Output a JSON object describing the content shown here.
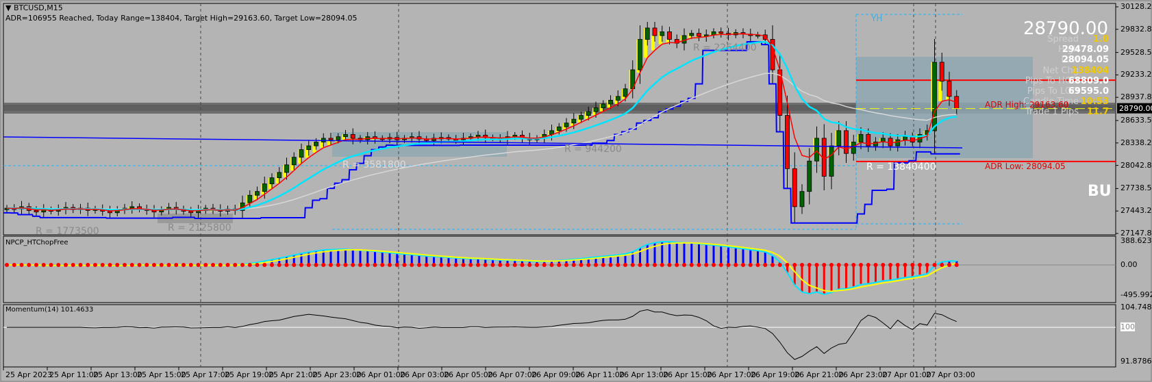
{
  "header": {
    "symbol": "BTCUSD,M15",
    "adr_line": "ADR=106955 Reached, Today Range=138404, Target High=29163.60, Target Low=28094.05"
  },
  "info_panel": {
    "price": "28790.00",
    "rows": [
      {
        "label": "Spread",
        "value": "1.0",
        "color": "#f0c800"
      },
      {
        "label": "High",
        "value": "29478.09",
        "color": "#ffffff"
      },
      {
        "label": "Low",
        "value": "28094.05",
        "color": "#ffffff"
      },
      {
        "label": "Net Chg",
        "value": "138404",
        "color": "#f0c800"
      },
      {
        "label": "Pips To HOD",
        "value": "68809.0",
        "color": "#ffffff"
      },
      {
        "label": "Pips To LOD",
        "value": "69595.0",
        "color": "#ffffff"
      },
      {
        "label": "Candle Time",
        "value": "10:53",
        "color": "#f0c800"
      },
      {
        "label": "Trade 1 Pips",
        "value": "11.7",
        "color": "#f0c800"
      }
    ],
    "bias": "BU"
  },
  "annotations": {
    "adr_high": "ADR High: 29163.60",
    "adr_low": "ADR Low: 28094.05",
    "yh": "YH",
    "ranges": [
      "R = 1773500",
      "R = 2125800",
      "R = 3581800",
      "R = 944200",
      "R = 2264400",
      "R = 13840400"
    ]
  },
  "colors": {
    "bg": "#b4b4b4",
    "bull": "#006400",
    "bear": "#ff0000",
    "adr": "#ff0000",
    "cyan": "#00e5ff",
    "blue": "#0000ff"
  },
  "chart_data": {
    "type": "line",
    "title": "BTCUSD,M15",
    "price_axis": {
      "ticks": [
        "30128.20",
        "29832.85",
        "29528.55",
        "29233.20",
        "28937.85",
        "28633.55",
        "28338.20",
        "28042.85",
        "27738.55",
        "27443.20",
        "27147.85"
      ],
      "ylim": [
        27147.85,
        30128.2
      ],
      "current": "28790.00"
    },
    "time_axis": {
      "ticks": [
        "25 Apr 2023",
        "25 Apr 11:00",
        "25 Apr 13:00",
        "25 Apr 15:00",
        "25 Apr 17:00",
        "25 Apr 19:00",
        "25 Apr 21:00",
        "25 Apr 23:00",
        "26 Apr 01:00",
        "26 Apr 03:00",
        "26 Apr 05:00",
        "26 Apr 07:00",
        "26 Apr 09:00",
        "26 Apr 11:00",
        "26 Apr 13:00",
        "26 Apr 15:00",
        "26 Apr 17:00",
        "26 Apr 19:00",
        "26 Apr 21:00",
        "26 Apr 23:00",
        "27 Apr 01:00",
        "27 Apr 03:00"
      ]
    },
    "adr_high": 29163.6,
    "adr_low": 28094.05,
    "closes": [
      27480,
      27470,
      27500,
      27450,
      27430,
      27460,
      27440,
      27470,
      27490,
      27460,
      27480,
      27450,
      27470,
      27440,
      27420,
      27460,
      27480,
      27500,
      27470,
      27450,
      27430,
      27460,
      27490,
      27470,
      27440,
      27420,
      27450,
      27480,
      27460,
      27440,
      27470,
      27450,
      27550,
      27650,
      27700,
      27800,
      27880,
      27950,
      28050,
      28150,
      28250,
      28300,
      28350,
      28400,
      28380,
      28420,
      28450,
      28400,
      28380,
      28420,
      28400,
      28390,
      28410,
      28380,
      28400,
      28420,
      28390,
      28370,
      28400,
      28410,
      28390,
      28380,
      28400,
      28420,
      28440,
      28410,
      28400,
      28390,
      28420,
      28440,
      28400,
      28380,
      28400,
      28450,
      28500,
      28550,
      28600,
      28650,
      28700,
      28750,
      28800,
      28850,
      28900,
      28950,
      29050,
      29300,
      29700,
      29850,
      29750,
      29800,
      29700,
      29650,
      29750,
      29780,
      29740,
      29760,
      29800,
      29780,
      29760,
      29790,
      29770,
      29750,
      29760,
      29700,
      29300,
      28700,
      28000,
      27500,
      27700,
      28100,
      28400,
      27900,
      28300,
      28500,
      28200,
      28350,
      28450,
      28300,
      28350,
      28400,
      28300,
      28380,
      28420,
      28350,
      28450,
      28500,
      29400,
      29150,
      28950,
      28790
    ],
    "indicator": {
      "name": "NPCP_HTChopFree",
      "ticks": [
        "388.6235",
        "0.00",
        "-495.9925"
      ],
      "ylim": [
        -495.9925,
        388.6235
      ]
    },
    "momentum": {
      "name": "Momentum(14) 101.4633",
      "ticks": [
        "104.7482",
        "100",
        "91.8786"
      ],
      "ylim": [
        91.8786,
        104.7482
      ]
    }
  }
}
